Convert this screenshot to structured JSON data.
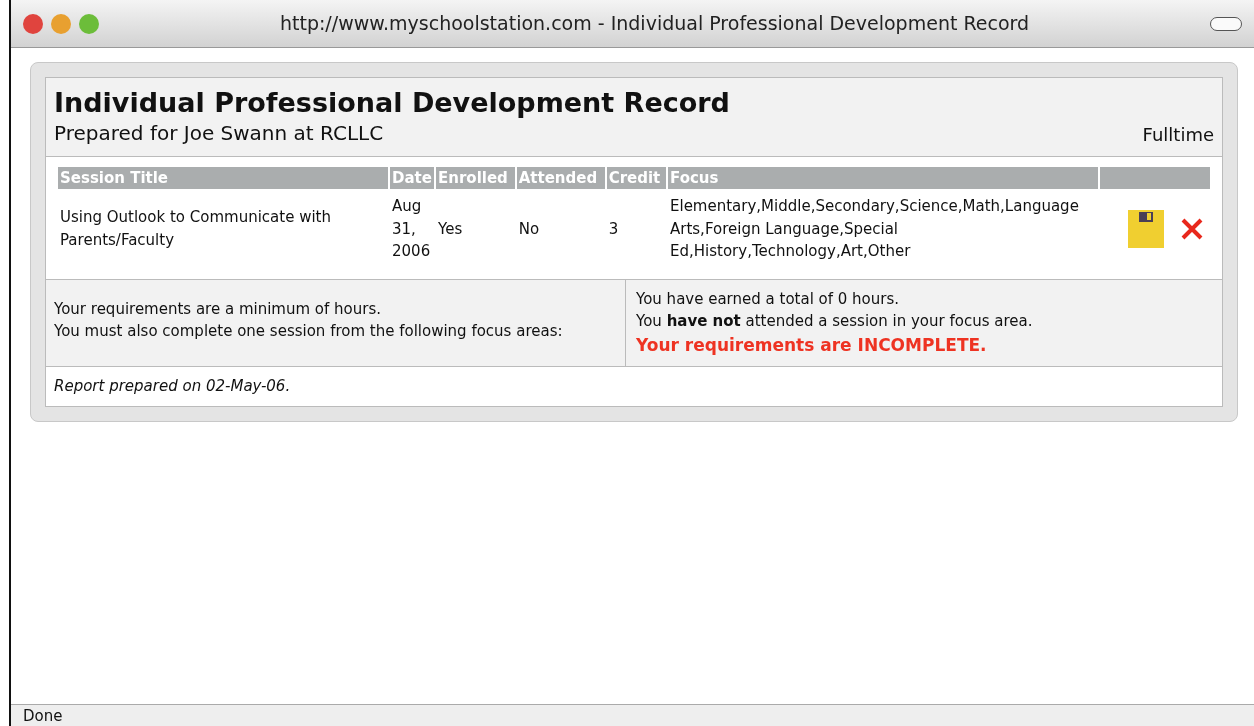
{
  "window": {
    "title": "http://www.myschoolstation.com - Individual Professional Development Record"
  },
  "record": {
    "title": "Individual Professional Development Record",
    "subtitle": "Prepared for Joe Swann at RCLLC",
    "status": "Fulltime"
  },
  "table": {
    "columns": [
      "Session Title",
      "Date",
      "Enrolled",
      "Attended",
      "Credit",
      "Focus"
    ],
    "rows": [
      {
        "cells": [
          "Using Outlook to Communicate with Parents/Faculty",
          "Aug 31, 2006",
          "Yes",
          "No",
          "3",
          "Elementary,Middle,Secondary,Science,Math,Language Arts,Foreign Language,Special Ed,History,Technology,Art,Other"
        ]
      }
    ]
  },
  "requirements": {
    "left": [
      "Your requirements are a minimum of hours.",
      "You must also complete one session from the following focus areas:"
    ],
    "right": [
      "You have earned a total of 0 hours.",
      "You **have not** attended a session in your focus area."
    ],
    "verdict": "Your requirements are INCOMPLETE."
  },
  "footer": "Report prepared on 02-May-06.",
  "status_bar": "Done"
}
